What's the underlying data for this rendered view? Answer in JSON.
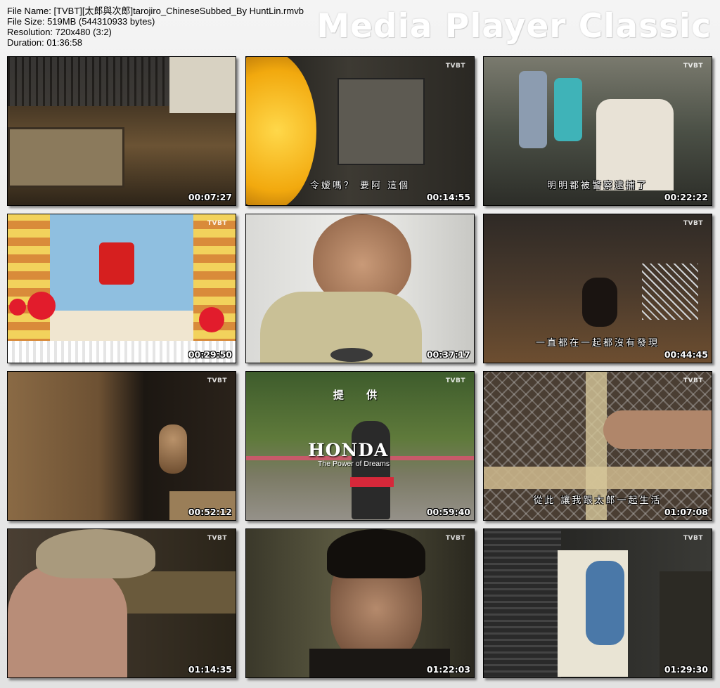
{
  "file_info": {
    "file_name": "File Name: [TVBT][太郎與次郎]tarojiro_ChineseSubbed_By HuntLin.rmvb",
    "file_size": "File Size: 519MB (544310933 bytes)",
    "resolution": "Resolution: 720x480 (3:2)",
    "duration": "Duration: 01:36:58"
  },
  "brand": "Media Player Classic",
  "channel_logo": "TVBT",
  "thumbnails": [
    {
      "time": "00:07:27",
      "subtitle": ""
    },
    {
      "time": "00:14:55",
      "subtitle": "令嫒嗎？ 要阿 這個"
    },
    {
      "time": "00:22:22",
      "subtitle": "明明都被警察逮捕了"
    },
    {
      "time": "00:29:50",
      "subtitle": ""
    },
    {
      "time": "00:37:17",
      "subtitle": ""
    },
    {
      "time": "00:44:45",
      "subtitle": "一直都在一起都沒有發現"
    },
    {
      "time": "00:52:12",
      "subtitle": ""
    },
    {
      "time": "00:59:40",
      "subtitle": "",
      "overlay_top": "提 供",
      "overlay_logo": "HONDA",
      "overlay_tagline": "The Power of Dreams"
    },
    {
      "time": "01:07:08",
      "subtitle": "從此 讓我跟太郎一起生活"
    },
    {
      "time": "01:14:35",
      "subtitle": ""
    },
    {
      "time": "01:22:03",
      "subtitle": ""
    },
    {
      "time": "01:29:30",
      "subtitle": ""
    }
  ]
}
